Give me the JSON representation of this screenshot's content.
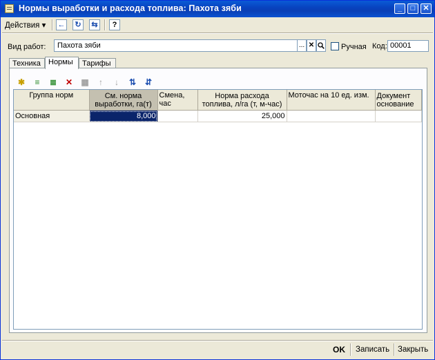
{
  "window": {
    "title": "Нормы выработки и расхода топлива: Пахота зяби",
    "min_glyph": "_",
    "max_glyph": "□",
    "close_glyph": "✕"
  },
  "menubar": {
    "actions_label": "Действия ▾"
  },
  "form": {
    "vid_label": "Вид работ:",
    "vid_value": "Пахота зяби",
    "select_glyph": "...",
    "clear_glyph": "✕",
    "search_glyph": "🔍",
    "manual_label": "Ручная",
    "manual_checked": false,
    "kod_label": "Код:",
    "kod_value": "00001"
  },
  "tabs": [
    {
      "label": "Техника"
    },
    {
      "label": "Нормы"
    },
    {
      "label": "Тарифы"
    }
  ],
  "grid": {
    "columns": [
      "Группа норм",
      "См. норма выработки, га(т)",
      "Смена, час",
      "Норма расхода топлива, л/га (т, м-час)",
      "Моточас на 10 ед. изм.",
      "Документ основание"
    ],
    "rows": [
      {
        "group": "Основная",
        "norm": "8,000",
        "shift": "",
        "fuel": "25,000",
        "motohour": "",
        "doc": ""
      }
    ]
  },
  "footer": {
    "ok_label": "OK",
    "save_label": "Записать",
    "close_label": "Закрыть"
  },
  "colors": {
    "title_bar": "#0843c0",
    "selection": "#0a246a",
    "panel": "#ece9d8"
  }
}
